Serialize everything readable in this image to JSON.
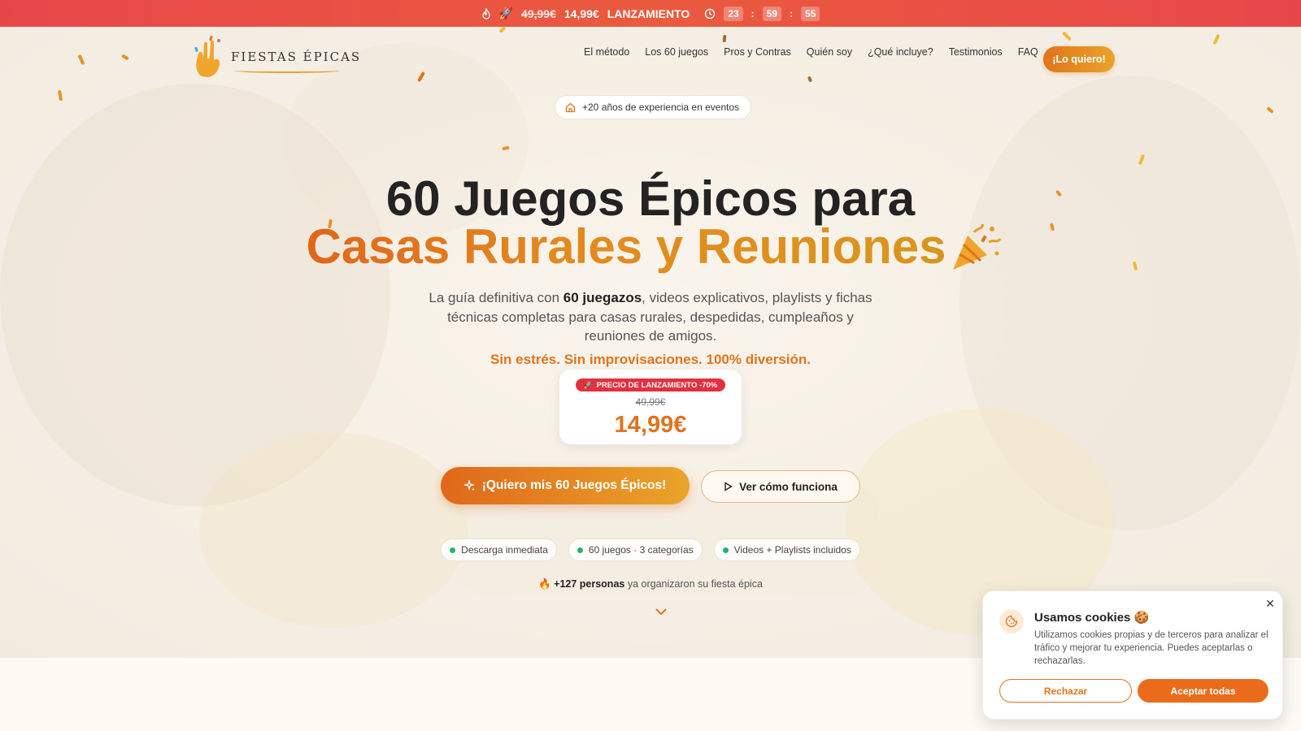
{
  "promo_bar": {
    "old_price": "49,99€",
    "new_price": "14,99€",
    "label": "LANZAMIENTO",
    "timer": {
      "hours": "23",
      "minutes": "59",
      "seconds": "55"
    }
  },
  "header": {
    "logo_text": "FIESTAS ÉPICAS",
    "nav": [
      "El método",
      "Los 60 juegos",
      "Pros y Contras",
      "Quién soy",
      "¿Qué incluye?",
      "Testimonios",
      "FAQ"
    ],
    "cta": "¡Lo quiero!"
  },
  "hero": {
    "experience_pill": "+20 años de experiencia en eventos",
    "title_line1": "60 Juegos Épicos para",
    "title_line2": "Casas Rurales y Reuniones",
    "subtitle_pre": "La guía definitiva con ",
    "subtitle_bold": "60 juegazos",
    "subtitle_post": ", videos explicativos, playlists y fichas técnicas completas para casas rurales, despedidas, cumpleaños y reuniones de amigos.",
    "tagline": "Sin estrés. Sin improvisaciones. 100% diversión.",
    "price": {
      "badge": "PRECIO DE LANZAMIENTO -70%",
      "old": "49,99€",
      "new": "14,99€"
    },
    "cta_primary": "¡Quiero mis 60 Juegos Épicos!",
    "cta_secondary": "Ver cómo funciona",
    "features": [
      "Descarga inmediata",
      "60 juegos · 3 categorías",
      "Videos + Playlists incluidos"
    ],
    "social_proof_bold": "+127 personas",
    "social_proof_rest": " ya organizaron su fiesta épica"
  },
  "cookie_banner": {
    "title": "Usamos cookies 🍪",
    "text": "Utilizamos cookies propias y de terceros para analizar el tráfico y mejorar tu experiencia. Puedes aceptarlas o rechazarlas.",
    "reject": "Rechazar",
    "accept": "Aceptar todas"
  },
  "colors": {
    "accent": "#e0741c",
    "promo_red": "#e8474a",
    "badge_red": "#e3303d",
    "success_dot": "#22b36b"
  },
  "icons": {
    "promo": [
      "flame-icon",
      "rocket-icon",
      "clock-icon"
    ],
    "experience": "home-icon",
    "cta_primary": "sparkles-icon",
    "cta_secondary": "play-icon",
    "social": "fire-icon",
    "scroll": "chevron-down-icon",
    "cookie": "cookie-icon",
    "close": "close-icon"
  }
}
